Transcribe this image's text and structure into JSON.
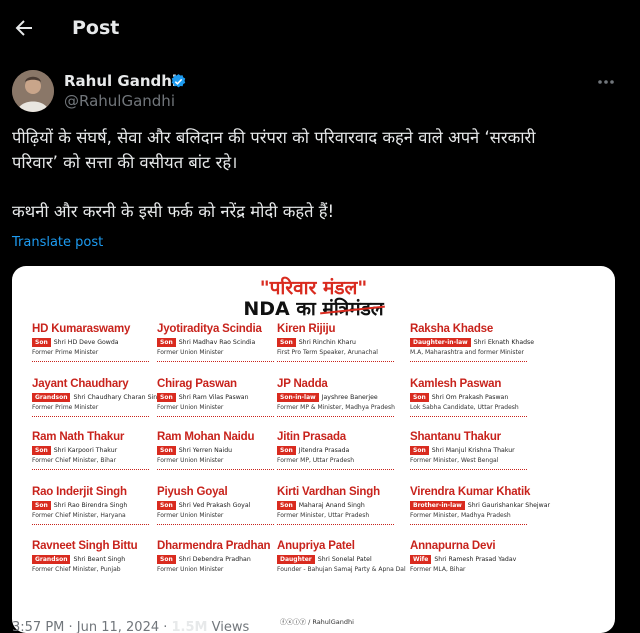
{
  "header": {
    "title": "Post"
  },
  "author": {
    "name": "Rahul Gandhi",
    "handle": "@RahulGandhi"
  },
  "tweet": {
    "line1": "पीढ़ियों के संघर्ष, सेवा और बलिदान की परंपरा को परिवारवाद कहने वाले अपने ‘सरकारी",
    "line2": "परिवार’ को सत्ता की वसीयत बांट रहे।",
    "line3": "कथनी और करनी के इसी फर्क को नरेंद्र मोदी कहते हैं!",
    "translate": "Translate post"
  },
  "card": {
    "title": "\"परिवार मंडल\"",
    "subtitle_prefix": "NDA का ",
    "subtitle_struck": "मंत्रिमंडल",
    "footer": "ⓕⓧⓘⓨ / RahulGandhi",
    "entries": [
      {
        "name": "HD Kumaraswamy",
        "rel": "Son",
        "relname": "Shri HD Deve Gowda",
        "role": "Former Prime Minister"
      },
      {
        "name": "Jyotiraditya Scindia",
        "rel": "Son",
        "relname": "Shri Madhav Rao Scindia",
        "role": "Former Union Minister"
      },
      {
        "name": "Kiren Rijiju",
        "rel": "Son",
        "relname": "Shri Rinchin Kharu",
        "role": "First Pro Term Speaker, Arunachal"
      },
      {
        "name": "Raksha Khadse",
        "rel": "Daughter-in-law",
        "relname": "Shri Eknath Khadse",
        "role": "M.A, Maharashtra and former Minister"
      },
      {
        "name": "Jayant Chaudhary",
        "rel": "Grandson",
        "relname": "Shri Chaudhary Charan Singh",
        "role": "Former Prime Minister"
      },
      {
        "name": "Chirag Paswan",
        "rel": "Son",
        "relname": "Shri Ram Vilas Paswan",
        "role": "Former Union Minister"
      },
      {
        "name": "JP Nadda",
        "rel": "Son-in-law",
        "relname": "Jayshree Banerjee",
        "role": "Former MP & Minister, Madhya Pradesh"
      },
      {
        "name": "Kamlesh Paswan",
        "rel": "Son",
        "relname": "Shri Om Prakash Paswan",
        "role": "Lok Sabha Candidate, Uttar Pradesh"
      },
      {
        "name": "Ram Nath Thakur",
        "rel": "Son",
        "relname": "Shri Karpoori Thakur",
        "role": "Former Chief Minister, Bihar"
      },
      {
        "name": "Ram Mohan Naidu",
        "rel": "Son",
        "relname": "Shri Yerren Naidu",
        "role": "Former Union Minister"
      },
      {
        "name": "Jitin Prasada",
        "rel": "Son",
        "relname": "Jitendra Prasada",
        "role": "Former MP, Uttar Pradesh"
      },
      {
        "name": "Shantanu Thakur",
        "rel": "Son",
        "relname": "Shri Manjul Krishna Thakur",
        "role": "Former Minister, West Bengal"
      },
      {
        "name": "Rao Inderjit Singh",
        "rel": "Son",
        "relname": "Shri Rao Birendra Singh",
        "role": "Former Chief Minister, Haryana"
      },
      {
        "name": "Piyush Goyal",
        "rel": "Son",
        "relname": "Shri Ved Prakash Goyal",
        "role": "Former Union Minister"
      },
      {
        "name": "Kirti Vardhan Singh",
        "rel": "Son",
        "relname": "Maharaj Anand Singh",
        "role": "Former Minister, Uttar Pradesh"
      },
      {
        "name": "Virendra Kumar Khatik",
        "rel": "Brother-in-law",
        "relname": "Shri Gaurishankar Shejwar",
        "role": "Former Minister, Madhya Pradesh"
      },
      {
        "name": "Ravneet Singh Bittu",
        "rel": "Grandson",
        "relname": "Shri Beant Singh",
        "role": "Former Chief Minister, Punjab"
      },
      {
        "name": "Dharmendra Pradhan",
        "rel": "Son",
        "relname": "Shri Debendra Pradhan",
        "role": "Former Union Minister"
      },
      {
        "name": "Anupriya Patel",
        "rel": "Daughter",
        "relname": "Shri Sonelal Patel",
        "role": "Founder - Bahujan Samaj Party & Apna Dal"
      },
      {
        "name": "Annapurna Devi",
        "rel": "Wife",
        "relname": "Shri Ramesh Prasad Yadav",
        "role": "Former MLA, Bihar"
      }
    ]
  },
  "meta": {
    "time": "3:57 PM · Jun 11, 2024 · ",
    "views": "1.5M",
    "views_label": " Views"
  },
  "colors": {
    "accent": "#1d9bf0",
    "card_red": "#d92b1f",
    "background": "#000000"
  }
}
